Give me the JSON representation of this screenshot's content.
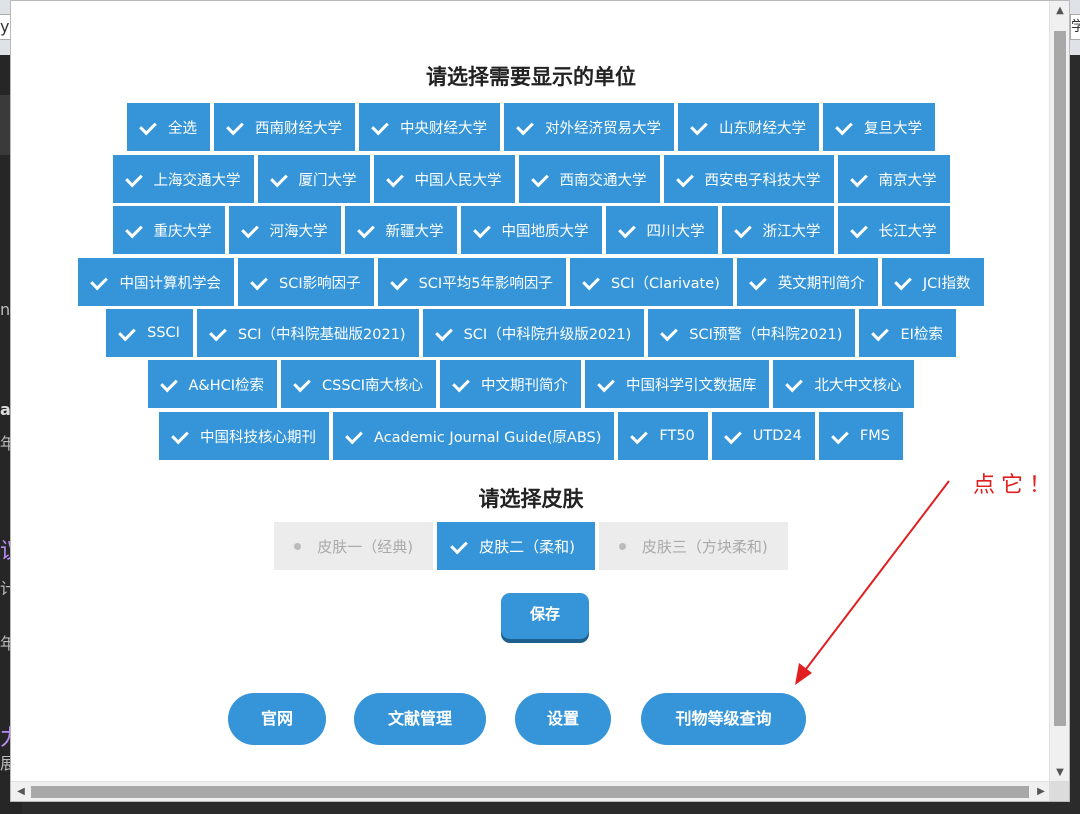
{
  "background": {
    "url_fragment_left": "y",
    "url_fragment_right": "学",
    "side_fragments": [
      "nc",
      "ar",
      "年",
      "议",
      "计",
      "年",
      "力",
      "展"
    ]
  },
  "units": {
    "heading": "请选择需要显示的单位",
    "rows": [
      [
        "全选",
        "西南财经大学",
        "中央财经大学",
        "对外经济贸易大学",
        "山东财经大学",
        "复旦大学"
      ],
      [
        "上海交通大学",
        "厦门大学",
        "中国人民大学",
        "西南交通大学",
        "西安电子科技大学",
        "南京大学"
      ],
      [
        "重庆大学",
        "河海大学",
        "新疆大学",
        "中国地质大学",
        "四川大学",
        "浙江大学",
        "长江大学"
      ],
      [
        "中国计算机学会",
        "SCI影响因子",
        "SCI平均5年影响因子",
        "SCI（Clarivate)",
        "英文期刊简介",
        "JCI指数"
      ],
      [
        "SSCI",
        "SCI（中科院基础版2021)",
        "SCI（中科院升级版2021)",
        "SCI预警（中科院2021)",
        "EI检索"
      ],
      [
        "A&HCI检索",
        "CSSCI南大核心",
        "中文期刊简介",
        "中国科学引文数据库",
        "北大中文核心"
      ],
      [
        "中国科技核心期刊",
        "Academic Journal Guide(原ABS)",
        "FT50",
        "UTD24",
        "FMS"
      ]
    ]
  },
  "skin": {
    "heading": "请选择皮肤",
    "options": [
      {
        "label": "皮肤一（经典)",
        "selected": false
      },
      {
        "label": "皮肤二（柔和)",
        "selected": true
      },
      {
        "label": "皮肤三（方块柔和)",
        "selected": false
      }
    ]
  },
  "save_label": "保存",
  "nav": {
    "official": "官网",
    "literature": "文献管理",
    "settings": "设置",
    "journal_rank": "刊物等级查询"
  },
  "annotation": "点它！",
  "colors": {
    "accent": "#3595d8",
    "annotation": "#e02020"
  }
}
